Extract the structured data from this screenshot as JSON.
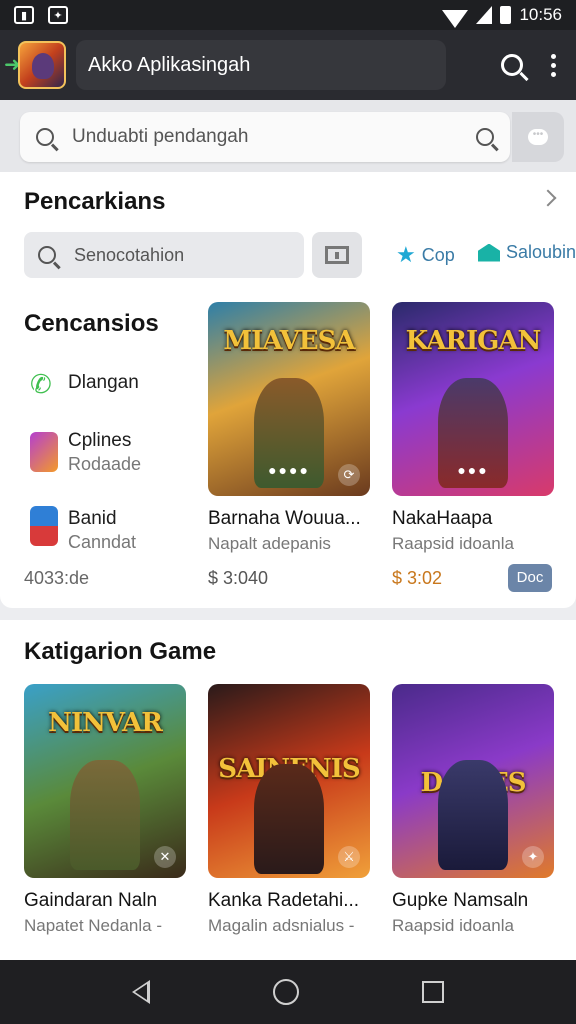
{
  "status_bar": {
    "time": "10:56"
  },
  "app_bar": {
    "title": "Akko Aplikasingah"
  },
  "search": {
    "placeholder": "Unduabti pendangah"
  },
  "section_search": {
    "title": "Pencarkians",
    "filter_placeholder": "Senocotahion",
    "chips": [
      "Cop",
      "Saloubin"
    ]
  },
  "section_categories": {
    "title": "Cencansios",
    "items": [
      {
        "label": "Dlangan",
        "sub": ""
      },
      {
        "label": "Cplines",
        "sub": "Rodaade"
      },
      {
        "label": "Banid",
        "sub": "Canndat"
      }
    ],
    "count": "4033:de",
    "games": [
      {
        "art_title": "MIAVESA",
        "name": "Barnaha Wouua...",
        "sub": "Napalt adepanis",
        "price": "$ 3:040"
      },
      {
        "art_title": "KARIGAN",
        "name": "NakaHaapa",
        "sub": "Raapsid idoanla",
        "price": "$ 3:02"
      }
    ],
    "get_label": "Doc"
  },
  "section_game_categories": {
    "title": "Katigarion Game",
    "games": [
      {
        "art_title": "NINVAR",
        "name": "Gaindaran Naln",
        "sub": "Napatet Nedanla -"
      },
      {
        "art_title": "SAINENIS",
        "name": "Kanka Radetahi...",
        "sub": "Magalin adsnialus -"
      },
      {
        "art_title": "DAMES",
        "name": "Gupke Namsaln",
        "sub": "Raapsid idoanla"
      }
    ]
  },
  "colors": {
    "appbar_bg": "#2a2b30",
    "status_bg": "#1e1f22",
    "accent_button": "#6b85a8",
    "price_orange": "#c8771c"
  }
}
